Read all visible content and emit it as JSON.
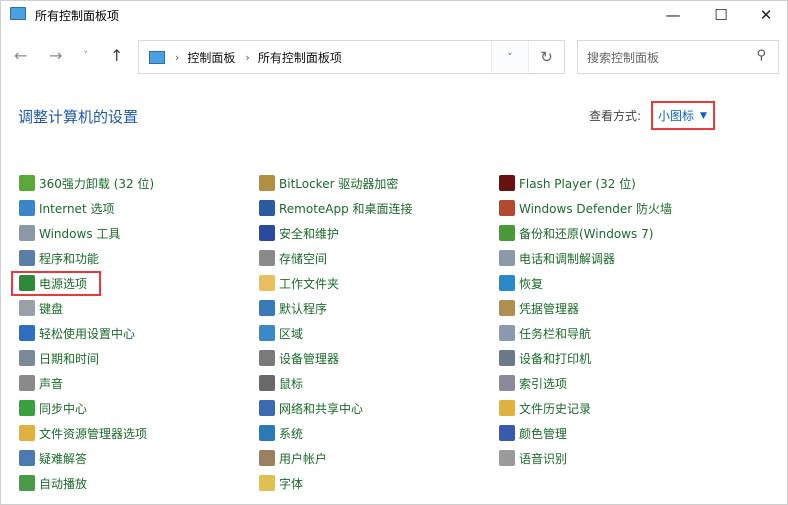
{
  "window": {
    "title": "所有控制面板项",
    "minimize": "—",
    "maximize": "☐",
    "close": "✕"
  },
  "nav": {
    "back": "←",
    "forward": "→",
    "recent": "˅",
    "up": "↑"
  },
  "address": {
    "crumbs": [
      "控制面板",
      "所有控制面板项"
    ],
    "sep": "›",
    "dropdown": "˅",
    "refresh": "↻"
  },
  "search": {
    "placeholder": "搜索控制面板",
    "icon": "⚲"
  },
  "heading": "调整计算机的设置",
  "view": {
    "label": "查看方式:",
    "value": "小图标",
    "arrow": "▼"
  },
  "columns": [
    [
      {
        "label": "360强力卸载 (32 位)",
        "color": "#5aa83a"
      },
      {
        "label": "Internet 选项",
        "color": "#3a86c8"
      },
      {
        "label": "Windows 工具",
        "color": "#8a98a8"
      },
      {
        "label": "程序和功能",
        "color": "#5a7ea8"
      },
      {
        "label": "电源选项",
        "color": "#2e8a3a"
      },
      {
        "label": "键盘",
        "color": "#9aa0a8"
      },
      {
        "label": "轻松使用设置中心",
        "color": "#2f6fc0"
      },
      {
        "label": "日期和时间",
        "color": "#7a8a9a"
      },
      {
        "label": "声音",
        "color": "#8a8a8a"
      },
      {
        "label": "同步中心",
        "color": "#3aa040"
      },
      {
        "label": "文件资源管理器选项",
        "color": "#e0b040"
      },
      {
        "label": "疑难解答",
        "color": "#4a7ab0"
      },
      {
        "label": "自动播放",
        "color": "#4a9a4a"
      }
    ],
    [
      {
        "label": "BitLocker 驱动器加密",
        "color": "#b09040"
      },
      {
        "label": "RemoteApp 和桌面连接",
        "color": "#2a5aa0"
      },
      {
        "label": "安全和维护",
        "color": "#2a4aa0"
      },
      {
        "label": "存储空间",
        "color": "#8a8a8a"
      },
      {
        "label": "工作文件夹",
        "color": "#e8c060"
      },
      {
        "label": "默认程序",
        "color": "#3a7ab8"
      },
      {
        "label": "区域",
        "color": "#3a8ac8"
      },
      {
        "label": "设备管理器",
        "color": "#7a7a7a"
      },
      {
        "label": "鼠标",
        "color": "#6a6a6a"
      },
      {
        "label": "网络和共享中心",
        "color": "#3a6ab0"
      },
      {
        "label": "系统",
        "color": "#2a7ab8"
      },
      {
        "label": "用户帐户",
        "color": "#9a8060"
      },
      {
        "label": "字体",
        "color": "#e0c050"
      }
    ],
    [
      {
        "label": "Flash Player (32 位)",
        "color": "#6a1010"
      },
      {
        "label": "Windows Defender 防火墙",
        "color": "#b04a30"
      },
      {
        "label": "备份和还原(Windows 7)",
        "color": "#4a9a3a"
      },
      {
        "label": "电话和调制解调器",
        "color": "#8a9aa8"
      },
      {
        "label": "恢复",
        "color": "#2a8ac8"
      },
      {
        "label": "凭据管理器",
        "color": "#b09050"
      },
      {
        "label": "任务栏和导航",
        "color": "#8a9ab0"
      },
      {
        "label": "设备和打印机",
        "color": "#6a7a8a"
      },
      {
        "label": "索引选项",
        "color": "#8a8a9a"
      },
      {
        "label": "文件历史记录",
        "color": "#e0b040"
      },
      {
        "label": "颜色管理",
        "color": "#3a5ab0"
      },
      {
        "label": "语音识别",
        "color": "#9a9a9a"
      }
    ]
  ]
}
